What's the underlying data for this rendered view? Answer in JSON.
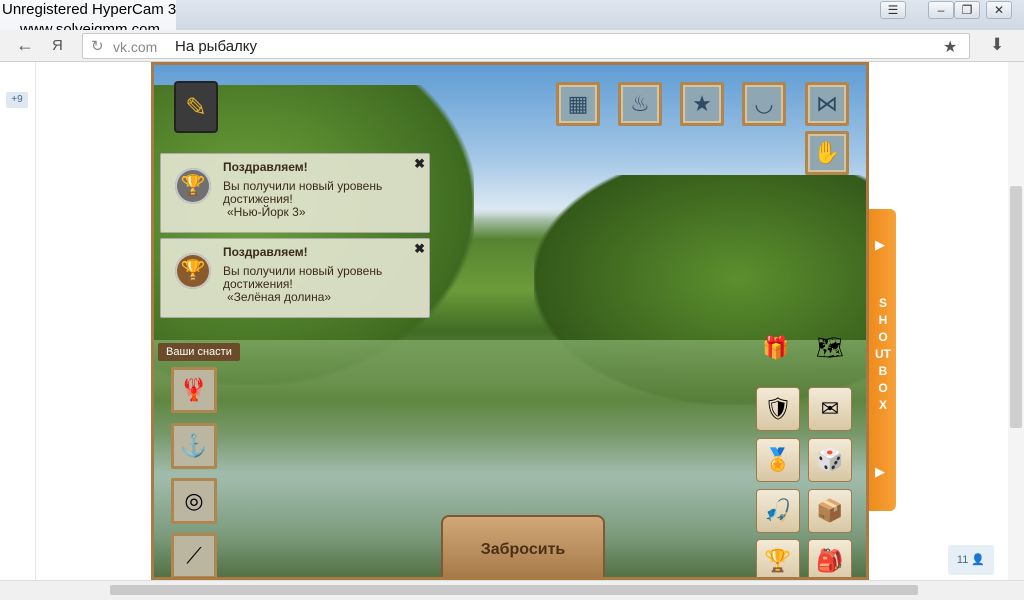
{
  "watermark": {
    "line1": "Unregistered HyperCam 3",
    "line2": "www.solveigmm.com"
  },
  "browser": {
    "url_host": "vk.com",
    "page_title": "На рыбалку",
    "back_glyph": "←",
    "yandex_glyph": "Я",
    "reload_glyph": "↻",
    "star_glyph": "★",
    "download_glyph": "⬇",
    "menu_glyph": "☰",
    "minimize_glyph": "–",
    "restore_glyph": "❐",
    "close_glyph": "✕"
  },
  "sidebar": {
    "badge": "+9"
  },
  "game": {
    "notebook_icon": "✎",
    "top_tools": [
      {
        "name": "net-icon",
        "glyph": "▦"
      },
      {
        "name": "fire-icon",
        "glyph": "♨"
      },
      {
        "name": "stars-icon",
        "glyph": "★"
      },
      {
        "name": "bucket-icon",
        "glyph": "◡"
      },
      {
        "name": "landing-net-icon",
        "glyph": "⋈"
      },
      {
        "name": "fish-bait-icon",
        "glyph": "✋"
      }
    ],
    "notifications": [
      {
        "title": "Поздравляем!",
        "line1": "Вы получили новый уровень",
        "line2": "достижения!",
        "line3": "«Нью-Йорк 3»",
        "close": "✖",
        "trophy": "🏆",
        "tone": "silver"
      },
      {
        "title": "Поздравляем!",
        "line1": "Вы получили новый уровень",
        "line2": "достижения!",
        "line3": "«Зелёная долина»",
        "close": "✖",
        "trophy": "🏆",
        "tone": "bronze"
      }
    ],
    "tackle_label": "Ваши снасти",
    "tackle_slots": [
      {
        "name": "crayfish-bait-slot",
        "glyph": "🦞"
      },
      {
        "name": "hook-slot",
        "glyph": "⚓"
      },
      {
        "name": "reel-slot",
        "glyph": "◎"
      },
      {
        "name": "rod-slot",
        "glyph": "⟋"
      }
    ],
    "right_buttons": [
      {
        "name": "gift-button",
        "glyph": "🎁"
      },
      {
        "name": "map-button",
        "glyph": "🗺"
      },
      {
        "name": "rank-shield-button",
        "glyph": "🛡"
      },
      {
        "name": "mail-button",
        "glyph": "✉"
      },
      {
        "name": "medal-button",
        "glyph": "🏅"
      },
      {
        "name": "dice-button",
        "glyph": "🎲"
      },
      {
        "name": "rod-shop-button",
        "glyph": "🎣"
      },
      {
        "name": "box-button",
        "glyph": "📦"
      },
      {
        "name": "trophy-button",
        "glyph": "🏆"
      },
      {
        "name": "backpack-button",
        "glyph": "🎒"
      }
    ],
    "cast_button": "Забросить",
    "shoutbox": {
      "label": "SHOUTBOX",
      "arrow_glyph": "▶"
    }
  },
  "footer": {
    "counter": "11 👤"
  }
}
